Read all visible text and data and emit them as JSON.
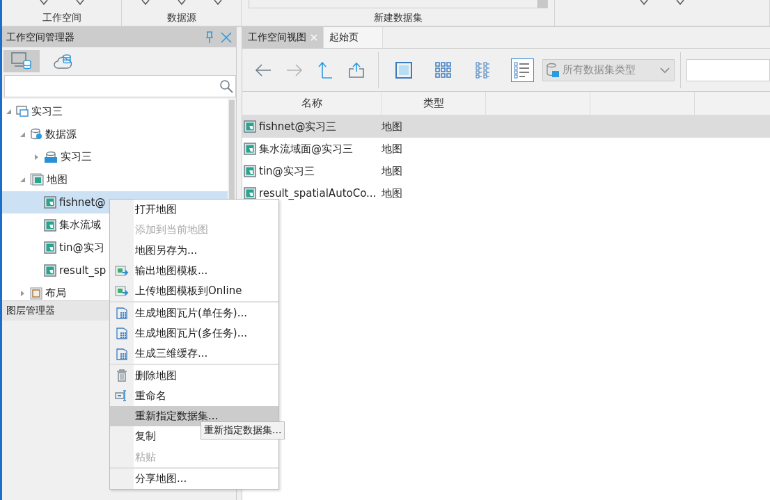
{
  "ribbon": {
    "groups": [
      {
        "label": "工作空间"
      },
      {
        "label": "数据源"
      },
      {
        "label": "新建数据集"
      }
    ]
  },
  "workspace_manager": {
    "title": "工作空间管理器",
    "icon_tabs": [
      {
        "kind": "local",
        "selected": true
      },
      {
        "kind": "cloud",
        "selected": false
      }
    ],
    "tree": [
      {
        "label": "实习三",
        "kind": "workspace",
        "expanded": true,
        "selected": false,
        "children": [
          {
            "label": "数据源",
            "kind": "datasources",
            "expanded": true,
            "selected": false,
            "children": [
              {
                "label": "实习三",
                "kind": "udx",
                "expanded": false,
                "selected": false
              }
            ]
          },
          {
            "label": "地图",
            "kind": "maps",
            "expanded": true,
            "selected": false,
            "children": [
              {
                "label": "fishnet@",
                "kind": "map",
                "selected": true
              },
              {
                "label": "集水流域",
                "kind": "map",
                "selected": false
              },
              {
                "label": "tin@实习",
                "kind": "map",
                "selected": false
              },
              {
                "label": "result_sp",
                "kind": "map",
                "selected": false
              }
            ]
          },
          {
            "label": "布局",
            "kind": "layouts",
            "expanded": false,
            "selected": false
          }
        ]
      }
    ]
  },
  "layer_manager": {
    "title": "图层管理器"
  },
  "tabs": [
    {
      "label": "工作空间视图",
      "selected": true,
      "closable": true
    },
    {
      "label": "起始页",
      "selected": false,
      "closable": false
    }
  ],
  "toolbar": {
    "views": [
      {
        "kind": "large",
        "selected": false
      },
      {
        "kind": "grid",
        "selected": false
      },
      {
        "kind": "tree",
        "selected": false
      },
      {
        "kind": "details",
        "selected": true
      }
    ],
    "filter": {
      "value": "所有数据集类型"
    }
  },
  "table": {
    "columns": [
      "名称",
      "类型"
    ],
    "rows": [
      {
        "name": "fishnet@实习三",
        "type": "地图",
        "selected": true
      },
      {
        "name": "集水流域面@实习三",
        "type": "地图",
        "selected": false
      },
      {
        "name": "tin@实习三",
        "type": "地图",
        "selected": false
      },
      {
        "name": "result_spatialAutoCo...",
        "type": "地图",
        "selected": false
      }
    ]
  },
  "context_menu": {
    "groups": [
      [
        {
          "label": "打开地图",
          "kind": "plain",
          "disabled": false,
          "selected": false
        },
        {
          "label": "添加到当前地图",
          "kind": "plain",
          "disabled": true,
          "selected": false
        },
        {
          "label": "地图另存为...",
          "kind": "plain",
          "disabled": false,
          "selected": false
        },
        {
          "label": "输出地图模板...",
          "kind": "template",
          "disabled": false,
          "selected": false
        },
        {
          "label": "上传地图模板到Online",
          "kind": "template",
          "disabled": false,
          "selected": false
        }
      ],
      [
        {
          "label": "生成地图瓦片(单任务)...",
          "kind": "tiles",
          "disabled": false,
          "selected": false
        },
        {
          "label": "生成地图瓦片(多任务)...",
          "kind": "tiles",
          "disabled": false,
          "selected": false
        },
        {
          "label": "生成三维缓存...",
          "kind": "tiles",
          "disabled": false,
          "selected": false
        }
      ],
      [
        {
          "label": "删除地图",
          "kind": "delete",
          "disabled": false,
          "selected": false
        },
        {
          "label": "重命名",
          "kind": "rename",
          "disabled": false,
          "selected": false
        },
        {
          "label": "重新指定数据集...",
          "kind": "plain",
          "disabled": false,
          "selected": true
        },
        {
          "label": "复制",
          "kind": "plain",
          "disabled": false,
          "selected": false
        },
        {
          "label": "粘贴",
          "kind": "plain",
          "disabled": true,
          "selected": false
        }
      ],
      [
        {
          "label": "分享地图...",
          "kind": "plain",
          "disabled": false,
          "selected": false
        }
      ]
    ]
  },
  "tooltip": {
    "text": "重新指定数据集..."
  }
}
